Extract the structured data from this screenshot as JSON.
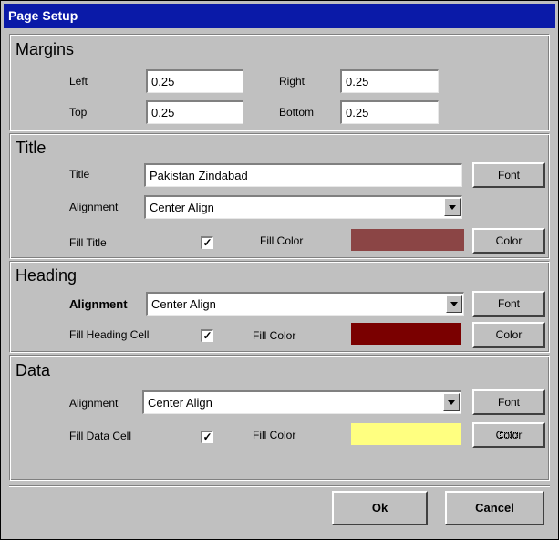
{
  "window": {
    "title": "Page Setup"
  },
  "margins": {
    "heading": "Margins",
    "left_label": "Left",
    "left_value": "0.25",
    "right_label": "Right",
    "right_value": "0.25",
    "top_label": "Top",
    "top_value": "0.25",
    "bottom_label": "Bottom",
    "bottom_value": "0.25"
  },
  "title_section": {
    "heading": "Title",
    "title_label": "Title",
    "title_value": "Pakistan Zindabad",
    "font_button": "Font",
    "alignment_label": "Alignment",
    "alignment_value": "Center Align",
    "fill_label": "Fill Title",
    "fill_checked": "✓",
    "fill_color_label": "Fill Color",
    "fill_color": "#8b4545",
    "color_button": "Color"
  },
  "heading_section": {
    "heading": "Heading",
    "alignment_label": "Alignment",
    "alignment_value": "Center Align",
    "font_button": "Font",
    "fill_label": "Fill Heading Cell",
    "fill_checked": "✓",
    "fill_color_label": "Fill Color",
    "fill_color": "#7a0000",
    "color_button": "Color"
  },
  "data_section": {
    "heading": "Data",
    "alignment_label": "Alignment",
    "alignment_value": "Center Align",
    "font_button": "Font",
    "fill_label": "Fill Data Cell",
    "fill_checked": "✓",
    "fill_color_label": "Fill Color",
    "fill_color": "#ffff80",
    "color_button": "Color"
  },
  "footer": {
    "ok_label": "Ok",
    "cancel_label": "Cancel"
  }
}
